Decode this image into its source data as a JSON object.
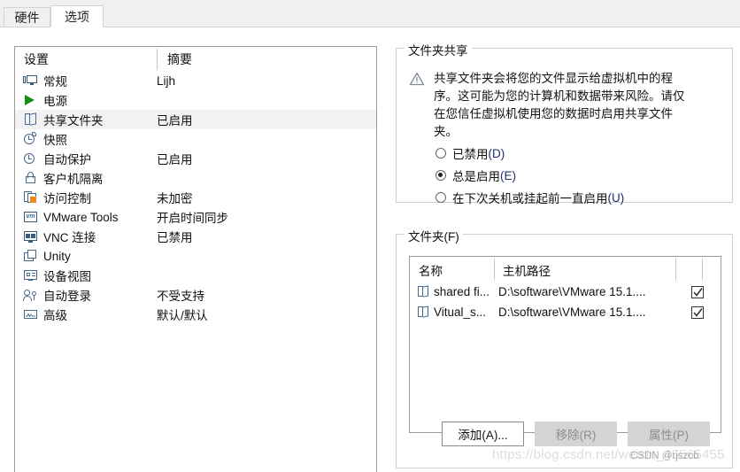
{
  "tabs": [
    {
      "label": "硬件",
      "active": false
    },
    {
      "label": "选项",
      "active": true
    }
  ],
  "settings_list": {
    "header": {
      "name": "设置",
      "summary": "摘要"
    },
    "rows": [
      {
        "icon": "monitor-icon",
        "label": "常规",
        "summary": "Lijh"
      },
      {
        "icon": "power-play-icon",
        "label": "电源",
        "summary": ""
      },
      {
        "icon": "shared-folder-icon",
        "label": "共享文件夹",
        "summary": "已启用",
        "selected": true
      },
      {
        "icon": "snapshot-clock-icon",
        "label": "快照",
        "summary": ""
      },
      {
        "icon": "autoprotect-clock-icon",
        "label": "自动保护",
        "summary": "已启用"
      },
      {
        "icon": "lock-icon",
        "label": "客户机隔离",
        "summary": ""
      },
      {
        "icon": "access-control-icon",
        "label": "访问控制",
        "summary": "未加密"
      },
      {
        "icon": "vmware-tools-icon",
        "label": "VMware Tools",
        "summary": "开启时间同步"
      },
      {
        "icon": "vnc-icon",
        "label": "VNC 连接",
        "summary": "已禁用"
      },
      {
        "icon": "unity-icon",
        "label": "Unity",
        "summary": ""
      },
      {
        "icon": "device-view-icon",
        "label": "设备视图",
        "summary": ""
      },
      {
        "icon": "auto-login-icon",
        "label": "自动登录",
        "summary": "不受支持"
      },
      {
        "icon": "advanced-icon",
        "label": "高级",
        "summary": "默认/默认"
      }
    ]
  },
  "folder_sharing": {
    "title": "文件夹共享",
    "warning_icon": "warning-triangle-icon",
    "warning_text": "共享文件夹会将您的文件显示给虚拟机中的程序。这可能为您的计算机和数据带来风险。请仅在您信任虚拟机使用您的数据时启用共享文件夹。",
    "options": [
      {
        "text": "已禁用",
        "mnemonic": "(D)",
        "selected": false
      },
      {
        "text": "总是启用",
        "mnemonic": "(E)",
        "selected": true
      },
      {
        "text": "在下次关机或挂起前一直启用",
        "mnemonic": "(U)",
        "selected": false
      }
    ]
  },
  "folders": {
    "title": "文件夹(F)",
    "columns": {
      "name": "名称",
      "path": "主机路径"
    },
    "rows": [
      {
        "icon": "folder-icon",
        "name": "shared fi...",
        "path": "D:\\software\\VMware 15.1....",
        "enabled": true
      },
      {
        "icon": "folder-icon",
        "name": "Vitual_s...",
        "path": "D:\\software\\VMware 15.1....",
        "enabled": true
      }
    ],
    "buttons": [
      {
        "label": "添加(A)...",
        "enabled": true
      },
      {
        "label": "移除(R)",
        "enabled": false
      },
      {
        "label": "属性(P)",
        "enabled": false
      }
    ]
  },
  "watermarks": {
    "url": "https://blog.csdn.net/weixin_45565455",
    "credit": "CSDN @rjszcb"
  }
}
